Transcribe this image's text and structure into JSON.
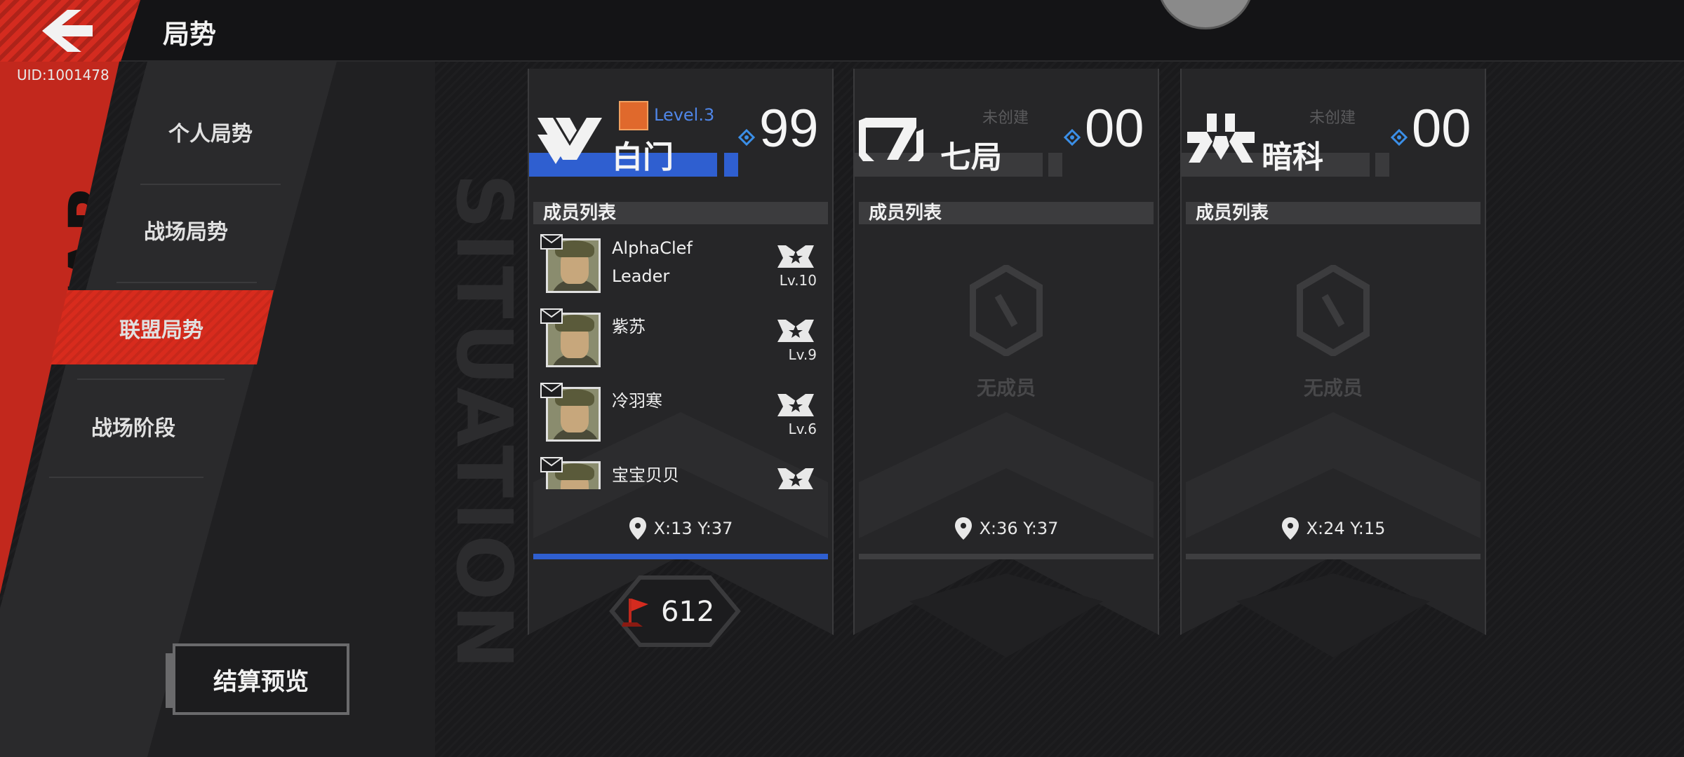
{
  "header": {
    "title": "局势",
    "uid": "UID:1001478"
  },
  "decor": {
    "side_red_text": "THE WAR",
    "side_vertical_text": "SITUATION"
  },
  "nav": {
    "items": [
      {
        "label": "个人局势",
        "active": false
      },
      {
        "label": "战场局势",
        "active": false
      },
      {
        "label": "联盟局势",
        "active": true
      },
      {
        "label": "战场阶段",
        "active": false
      }
    ],
    "settle_button": "结算预览"
  },
  "colors": {
    "accent_red": "#d82b1d",
    "accent_blue": "#2f5fd0",
    "level_blue": "#4f86e8"
  },
  "factions": [
    {
      "name": "白门",
      "level": "Level.3",
      "status": "",
      "score": "99",
      "members_header": "成员列表",
      "members": [
        {
          "name": "AlphaClef",
          "role": "Leader",
          "level": "Lv.10"
        },
        {
          "name": "紫苏",
          "role": "",
          "level": "Lv.9"
        },
        {
          "name": "冷羽寒",
          "role": "",
          "level": "Lv.6"
        },
        {
          "name": "宝宝贝贝",
          "role": "",
          "level": ""
        }
      ],
      "empty_text": "",
      "coords": "X:13 Y:37",
      "flag_count": "612"
    },
    {
      "name": "七局",
      "level": "",
      "status": "未创建",
      "score": "00",
      "members_header": "成员列表",
      "members": [],
      "empty_text": "无成员",
      "coords": "X:36 Y:37",
      "flag_count": ""
    },
    {
      "name": "暗科",
      "level": "",
      "status": "未创建",
      "score": "00",
      "members_header": "成员列表",
      "members": [],
      "empty_text": "无成员",
      "coords": "X:24 Y:15",
      "flag_count": ""
    }
  ]
}
